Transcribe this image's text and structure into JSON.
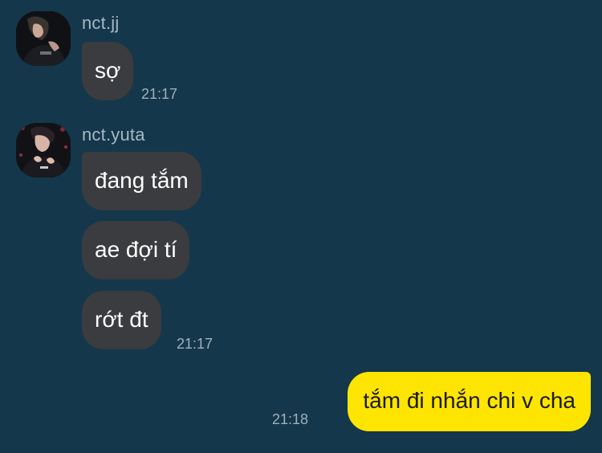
{
  "colors": {
    "background": "#14374b",
    "incoming_bubble": "#3a3c3f",
    "outgoing_bubble": "#fee500",
    "sender_name": "#a7b8c3",
    "timestamp": "#9fb0bc"
  },
  "messages": [
    {
      "sender": "nct.jj",
      "avatar_icon": "profile-photo",
      "bubbles": [
        "sợ"
      ],
      "time": "21:17"
    },
    {
      "sender": "nct.yuta",
      "avatar_icon": "profile-photo",
      "bubbles": [
        "đang tắm",
        "ae đợi tí",
        "rớt đt"
      ],
      "time": "21:17"
    }
  ],
  "outgoing": {
    "text": "tắm đi nhắn chi v cha",
    "time": "21:18"
  }
}
